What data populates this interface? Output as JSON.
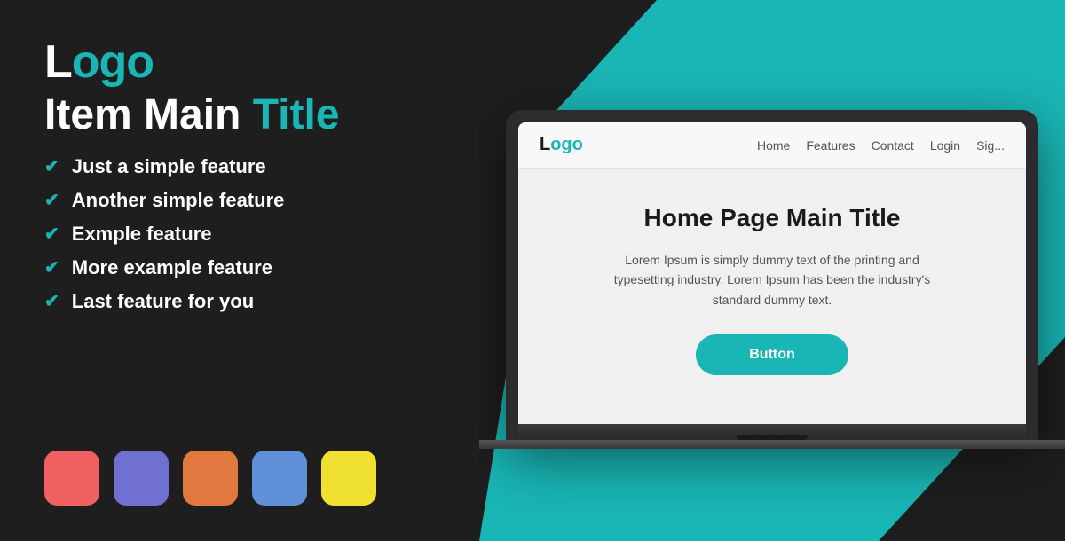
{
  "left": {
    "logo": {
      "text_normal": "L",
      "text_accent": "ogo",
      "full": "Logo"
    },
    "main_title_normal": "Item Main ",
    "main_title_accent": "Title",
    "features": [
      "Just a simple feature",
      "Another simple feature",
      "Exmple feature",
      "More example feature",
      "Last feature for you"
    ],
    "swatches": [
      {
        "color": "#f06060",
        "name": "red"
      },
      {
        "color": "#7070d0",
        "name": "purple"
      },
      {
        "color": "#e07840",
        "name": "orange"
      },
      {
        "color": "#6090d8",
        "name": "blue"
      },
      {
        "color": "#f0e030",
        "name": "yellow"
      }
    ]
  },
  "right": {
    "screen": {
      "logo_normal": "L",
      "logo_accent": "ogo",
      "logo_full": "Logo",
      "nav_links": [
        "Home",
        "Features",
        "Contact",
        "Login",
        "Sig..."
      ],
      "title": "Home Page Main Title",
      "body": "Lorem Ipsum is simply dummy text of the printing and typesetting industry. Lorem Ipsum has been the industry's standard dummy text.",
      "button_label": "Button"
    }
  }
}
